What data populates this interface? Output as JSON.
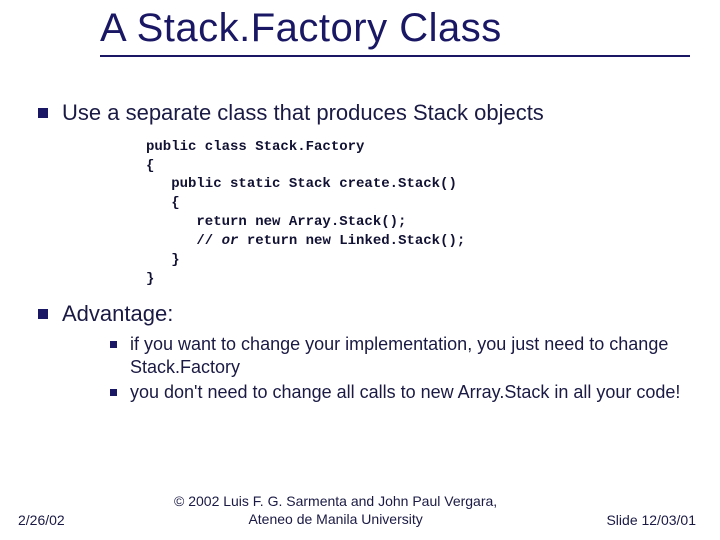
{
  "title": "A Stack.Factory Class",
  "bullets": [
    {
      "text": "Use a separate class that produces Stack objects"
    },
    {
      "text": "Advantage:"
    }
  ],
  "code": {
    "l1": "public class Stack.Factory",
    "l2": "{",
    "l3": "   public static Stack create.Stack()",
    "l4": "   {",
    "l5": "      return new Array.Stack();",
    "l6_prefix": "      // ",
    "l6_italic": "or ",
    "l6_rest": "return new Linked.Stack();",
    "l7": "   }",
    "l8": "}"
  },
  "sub_bullets": [
    "if you want to change your implementation, you just need to change Stack.Factory",
    "you don't need to change all calls to new Array.Stack in all your code!"
  ],
  "footer": {
    "date": "2/26/02",
    "copyright_line1": "© 2002 Luis F. G. Sarmenta and John Paul Vergara,",
    "copyright_line2": "Ateneo de Manila University",
    "slide_number": "Slide 12/03/01"
  }
}
